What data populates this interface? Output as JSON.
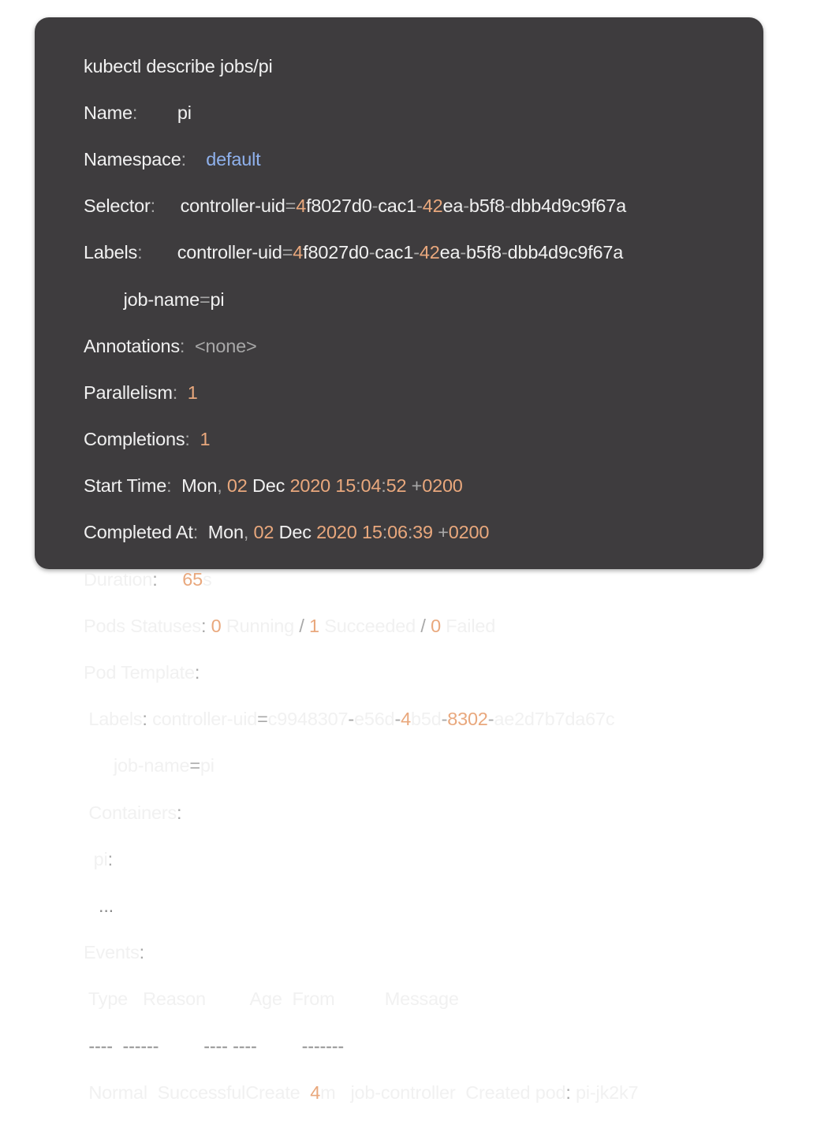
{
  "colors": {
    "background": "#3e3c3e",
    "text": "#f1f1f1",
    "dim": "#a8a8a8",
    "number": "#e9a87d",
    "link": "#8fb1ec"
  },
  "cmd": "kubectl describe jobs/pi",
  "name": {
    "key": "Name",
    "colon": ":",
    "value": "pi"
  },
  "namespace": {
    "key": "Namespace",
    "colon": ":",
    "value": "default"
  },
  "selector": {
    "key": "Selector",
    "colon": ":",
    "p1": "controller-uid",
    "eq": "=",
    "p2": "4",
    "p3": "f8027d0",
    "d1": "-",
    "p4": "cac1",
    "d2": "-",
    "p5": "42",
    "p6": "ea",
    "d3": "-",
    "p7": "b5f8",
    "d4": "-",
    "p8": "dbb4d9c9f67a"
  },
  "labels": {
    "key": "Labels",
    "colon": ":",
    "p1": "controller-uid",
    "eq": "=",
    "p2": "4",
    "p3": "f8027d0",
    "d1": "-",
    "p4": "cac1",
    "d2": "-",
    "p5": "42",
    "p6": "ea",
    "d3": "-",
    "p7": "b5f8",
    "d4": "-",
    "p8": "dbb4d9c9f67a",
    "jobname_key": "job-name",
    "jobname_eq": "=",
    "jobname_val": "pi"
  },
  "annotations": {
    "key": "Annotations",
    "colon": ":",
    "value": "<none>"
  },
  "parallelism": {
    "key": "Parallelism",
    "colon": ":",
    "value": "1"
  },
  "completions": {
    "key": "Completions",
    "colon": ":",
    "value": "1"
  },
  "start_time": {
    "key": "Start Time",
    "colon": ":",
    "day": "Mon",
    "comma": ",",
    "date": "02",
    "month": "Dec",
    "year": "2020",
    "hh": "15",
    "c1": ":",
    "mm": "04",
    "c2": ":",
    "ss": "52",
    "plus": "+",
    "tz": "0200"
  },
  "completed_at": {
    "key": "Completed At",
    "colon": ":",
    "day": "Mon",
    "comma": ",",
    "date": "02",
    "month": "Dec",
    "year": "2020",
    "hh": "15",
    "c1": ":",
    "mm": "06",
    "c2": ":",
    "ss": "39",
    "plus": "+",
    "tz": "0200"
  },
  "duration": {
    "key": "Duration",
    "colon": ":",
    "num": "65",
    "unit": "s"
  },
  "pods_statuses": {
    "key": "Pods Statuses",
    "colon": ":",
    "running_n": "0",
    "running": "Running",
    "slash1": "/",
    "succeeded_n": "1",
    "succeeded": "Succeeded",
    "slash2": "/",
    "failed_n": "0",
    "failed": "Failed"
  },
  "pod_template": {
    "key": "Pod Template",
    "colon": ":",
    "labels_key": "Labels",
    "labels_colon": ":",
    "l1": "controller-uid",
    "leq": "=",
    "l2": "c9948307",
    "ld1": "-",
    "l3": "e56d",
    "ld2": "-",
    "l4": "4",
    "l5": "b5d",
    "ld3": "-",
    "l6": "8302",
    "ld4": "-",
    "l7": "ae2d7b7da67c",
    "jobname_key": "job-name",
    "jobname_eq": "=",
    "jobname_val": "pi",
    "containers_key": "Containers",
    "containers_colon": ":",
    "pi_key": "pi",
    "pi_colon": ":",
    "ellipsis": "..."
  },
  "events": {
    "key": "Events",
    "colon": ":",
    "headers": [
      "Type",
      "Reason",
      "Age",
      "From",
      "Message"
    ],
    "separators": [
      "----",
      "------",
      "----",
      "----",
      "-------"
    ],
    "row": {
      "type": "Normal",
      "reason": "SuccessfulCreate",
      "age_n": "4",
      "age_u": "m",
      "from": "job-controller",
      "msg": "Created pod",
      "msg_colon": ":",
      "pod": "pi-jk2k7"
    }
  }
}
